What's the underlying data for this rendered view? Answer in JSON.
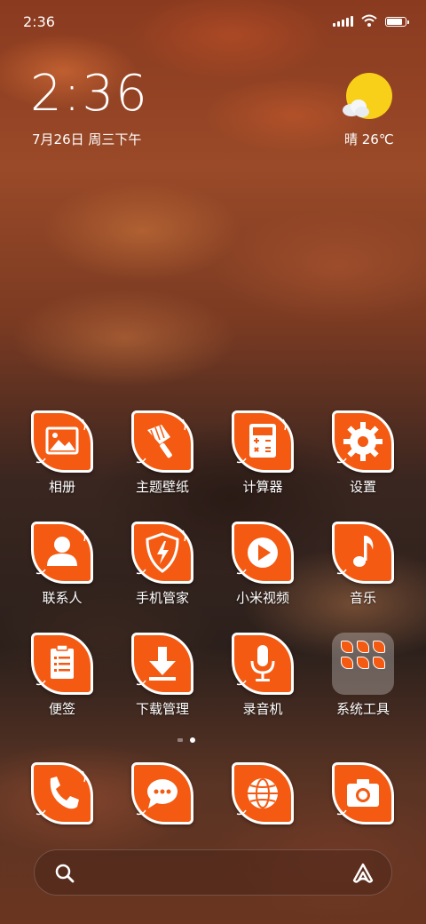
{
  "status_bar": {
    "time": "2:36",
    "icons": [
      "signal-icon",
      "wifi-icon",
      "battery-icon"
    ]
  },
  "clock_widget": {
    "time": "2:36",
    "date": "7月26日 周三下午"
  },
  "weather_widget": {
    "icon": "partly-sunny-icon",
    "text": "晴 26℃"
  },
  "apps": [
    {
      "label": "相册",
      "icon": "gallery-icon"
    },
    {
      "label": "主题壁纸",
      "icon": "themes-brush-icon"
    },
    {
      "label": "计算器",
      "icon": "calculator-icon"
    },
    {
      "label": "设置",
      "icon": "gear-icon"
    },
    {
      "label": "联系人",
      "icon": "contact-person-icon"
    },
    {
      "label": "手机管家",
      "icon": "security-shield-icon"
    },
    {
      "label": "小米视频",
      "icon": "play-video-icon"
    },
    {
      "label": "音乐",
      "icon": "music-note-icon"
    },
    {
      "label": "便签",
      "icon": "notes-clipboard-icon"
    },
    {
      "label": "下载管理",
      "icon": "download-arrow-icon"
    },
    {
      "label": "录音机",
      "icon": "microphone-icon"
    },
    {
      "label": "系统工具",
      "icon": "folder-icon"
    }
  ],
  "dock": [
    {
      "icon": "phone-icon"
    },
    {
      "icon": "messages-icon"
    },
    {
      "icon": "browser-globe-icon"
    },
    {
      "icon": "camera-icon"
    }
  ],
  "page_indicator": {
    "pages": 2,
    "current": 1
  },
  "search_bar": {
    "left_icon": "search-icon",
    "right_icon": "assistant-icon"
  },
  "colors": {
    "icon_fill": "#f45a12",
    "icon_border": "#ffffff",
    "text": "#ffffff"
  }
}
